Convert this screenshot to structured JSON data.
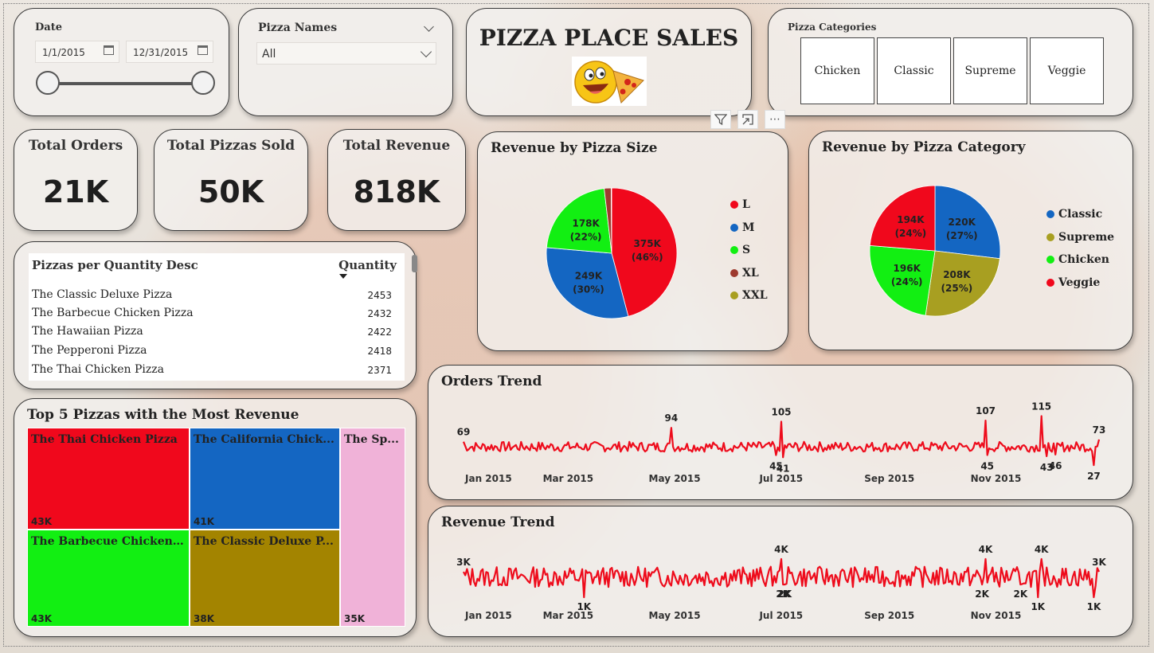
{
  "header": {
    "title": "PIZZA PLACE SALES"
  },
  "date_slicer": {
    "label": "Date",
    "start": "1/1/2015",
    "end": "12/31/2015"
  },
  "pizza_names": {
    "label": "Pizza Names",
    "selected": "All"
  },
  "categories": {
    "label": "Pizza Categories",
    "items": [
      "Chicken",
      "Classic",
      "Supreme",
      "Veggie"
    ]
  },
  "kpis": [
    {
      "label": "Total Orders",
      "value": "21K"
    },
    {
      "label": "Total Pizzas Sold",
      "value": "50K"
    },
    {
      "label": "Total Revenue",
      "value": "818K"
    }
  ],
  "qty_table": {
    "col_name": "Pizzas per Quantity Desc",
    "col_qty": "Quantity",
    "rows": [
      {
        "name": "The Classic Deluxe Pizza",
        "qty": "2453"
      },
      {
        "name": "The Barbecue Chicken Pizza",
        "qty": "2432"
      },
      {
        "name": "The Hawaiian Pizza",
        "qty": "2422"
      },
      {
        "name": "The Pepperoni Pizza",
        "qty": "2418"
      },
      {
        "name": "The Thai Chicken Pizza",
        "qty": "2371"
      }
    ]
  },
  "colors": {
    "red": "#f0081c",
    "blue": "#1466c2",
    "green": "#12ef12",
    "olive": "#a89f21",
    "brown": "#9e3a2f",
    "gold": "#a38400",
    "pink": "#f0b2d8",
    "line": "#ee0c1c"
  },
  "chart_data": [
    {
      "type": "pie",
      "title": "Revenue by Pizza Size",
      "legend": [
        "L",
        "M",
        "S",
        "XL",
        "XXL"
      ],
      "slices": [
        {
          "name": "L",
          "value": 375,
          "label": "375K",
          "pct": "(46%)"
        },
        {
          "name": "M",
          "value": 249,
          "label": "249K",
          "pct": "(30%)"
        },
        {
          "name": "S",
          "value": 178,
          "label": "178K",
          "pct": "(22%)"
        },
        {
          "name": "XL",
          "value": 14,
          "label": "",
          "pct": ""
        },
        {
          "name": "XXL",
          "value": 1,
          "label": "",
          "pct": ""
        }
      ]
    },
    {
      "type": "pie",
      "title": "Revenue by Pizza Category",
      "legend": [
        "Classic",
        "Supreme",
        "Chicken",
        "Veggie"
      ],
      "slices": [
        {
          "name": "Classic",
          "value": 220,
          "label": "220K",
          "pct": "(27%)"
        },
        {
          "name": "Supreme",
          "value": 208,
          "label": "208K",
          "pct": "(25%)"
        },
        {
          "name": "Chicken",
          "value": 196,
          "label": "196K",
          "pct": "(24%)"
        },
        {
          "name": "Veggie",
          "value": 194,
          "label": "194K",
          "pct": "(24%)"
        }
      ]
    },
    {
      "type": "table",
      "title": "Top 5 Pizzas with the Most Revenue",
      "items": [
        {
          "name": "The Thai Chicken Pizza",
          "value": 43,
          "label": "43K"
        },
        {
          "name": "The Barbecue Chicken Pizza",
          "value": 43,
          "label": "43K"
        },
        {
          "name": "The California Chicken Pizza",
          "value": 41,
          "label": "41K"
        },
        {
          "name": "The Classic Deluxe Pizza",
          "value": 38,
          "label": "38K"
        },
        {
          "name": "The Spicy Italian Pizza",
          "value": 35,
          "label": "35K"
        }
      ],
      "display_names": [
        "The Thai Chicken Pizza",
        "The Barbecue Chicken ...",
        "The California Chick...",
        "The Classic Deluxe P...",
        "The Sp..."
      ]
    },
    {
      "type": "line",
      "title": "Orders Trend",
      "x_ticks": [
        "Jan 2015",
        "Mar 2015",
        "May 2015",
        "Jul 2015",
        "Sep 2015",
        "Nov 2015"
      ],
      "ylim": [
        20,
        120
      ],
      "annotations": [
        {
          "day": 1,
          "value": 69,
          "label": "69"
        },
        {
          "day": 120,
          "value": 94,
          "label": "94"
        },
        {
          "day": 183,
          "value": 105,
          "label": "105"
        },
        {
          "day": 180,
          "value": 45,
          "label": "45"
        },
        {
          "day": 184,
          "value": 41,
          "label": "41"
        },
        {
          "day": 300,
          "value": 107,
          "label": "107"
        },
        {
          "day": 301,
          "value": 45,
          "label": "45"
        },
        {
          "day": 332,
          "value": 115,
          "label": "115"
        },
        {
          "day": 335,
          "value": 43,
          "label": "43"
        },
        {
          "day": 340,
          "value": 46,
          "label": "46"
        },
        {
          "day": 365,
          "value": 73,
          "label": "73"
        },
        {
          "day": 362,
          "value": 27,
          "label": "27"
        }
      ]
    },
    {
      "type": "line",
      "title": "Revenue Trend",
      "x_ticks": [
        "Jan 2015",
        "Mar 2015",
        "May 2015",
        "Jul 2015",
        "Sep 2015",
        "Nov 2015"
      ],
      "ylim": [
        0,
        5
      ],
      "annotations": [
        {
          "day": 1,
          "value": 3,
          "label": "3K"
        },
        {
          "day": 70,
          "value": 1,
          "label": "1K"
        },
        {
          "day": 183,
          "value": 4,
          "label": "4K"
        },
        {
          "day": 184,
          "value": 2,
          "label": "2K"
        },
        {
          "day": 185,
          "value": 2,
          "label": "2K"
        },
        {
          "day": 300,
          "value": 4,
          "label": "4K"
        },
        {
          "day": 298,
          "value": 2,
          "label": "2K"
        },
        {
          "day": 320,
          "value": 2,
          "label": "2K"
        },
        {
          "day": 332,
          "value": 4,
          "label": "4K"
        },
        {
          "day": 330,
          "value": 1,
          "label": "1K"
        },
        {
          "day": 365,
          "value": 3,
          "label": "3K"
        },
        {
          "day": 362,
          "value": 1,
          "label": "1K"
        }
      ]
    }
  ]
}
